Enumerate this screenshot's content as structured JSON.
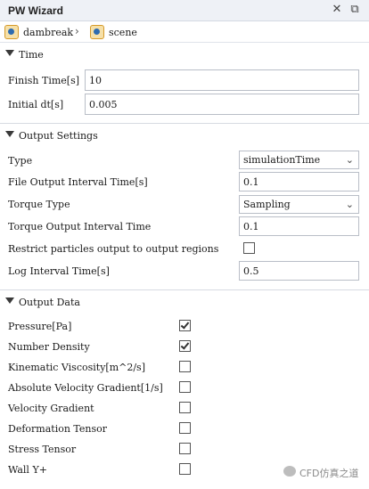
{
  "window": {
    "title": "PW Wizard",
    "close_glyph": "✕",
    "dock_glyph": "⧉"
  },
  "breadcrumb": {
    "items": [
      {
        "label": "dambreak",
        "icon": "project-icon"
      },
      {
        "label": "scene",
        "icon": "scene-icon"
      }
    ],
    "separator": "›"
  },
  "sections": {
    "time": {
      "title": "Time",
      "fields": {
        "finish_time": {
          "label": "Finish Time[s]",
          "value": "10"
        },
        "initial_dt": {
          "label": "Initial dt[s]",
          "value": "0.005"
        }
      }
    },
    "output_settings": {
      "title": "Output Settings",
      "type": {
        "label": "Type",
        "value": "simulationTime"
      },
      "file_output_interval": {
        "label": "File Output Interval Time[s]",
        "value": "0.1"
      },
      "torque_type": {
        "label": "Torque Type",
        "value": "Sampling"
      },
      "torque_output_interval": {
        "label": "Torque Output Interval Time",
        "value": "0.1"
      },
      "restrict_particles": {
        "label": "Restrict particles output to output regions",
        "checked": false
      },
      "log_interval": {
        "label": "Log Interval Time[s]",
        "value": "0.5"
      }
    },
    "output_data": {
      "title": "Output Data",
      "items": [
        {
          "label": "Pressure[Pa]",
          "checked": true
        },
        {
          "label": "Number Density",
          "checked": true
        },
        {
          "label": "Kinematic Viscosity[m^2/s]",
          "checked": false
        },
        {
          "label": "Absolute Velocity Gradient[1/s]",
          "checked": false
        },
        {
          "label": "Velocity Gradient",
          "checked": false
        },
        {
          "label": "Deformation Tensor",
          "checked": false
        },
        {
          "label": "Stress Tensor",
          "checked": false
        },
        {
          "label": "Wall Y+",
          "checked": false
        }
      ]
    }
  },
  "watermark": {
    "text": "CFD仿真之道"
  }
}
